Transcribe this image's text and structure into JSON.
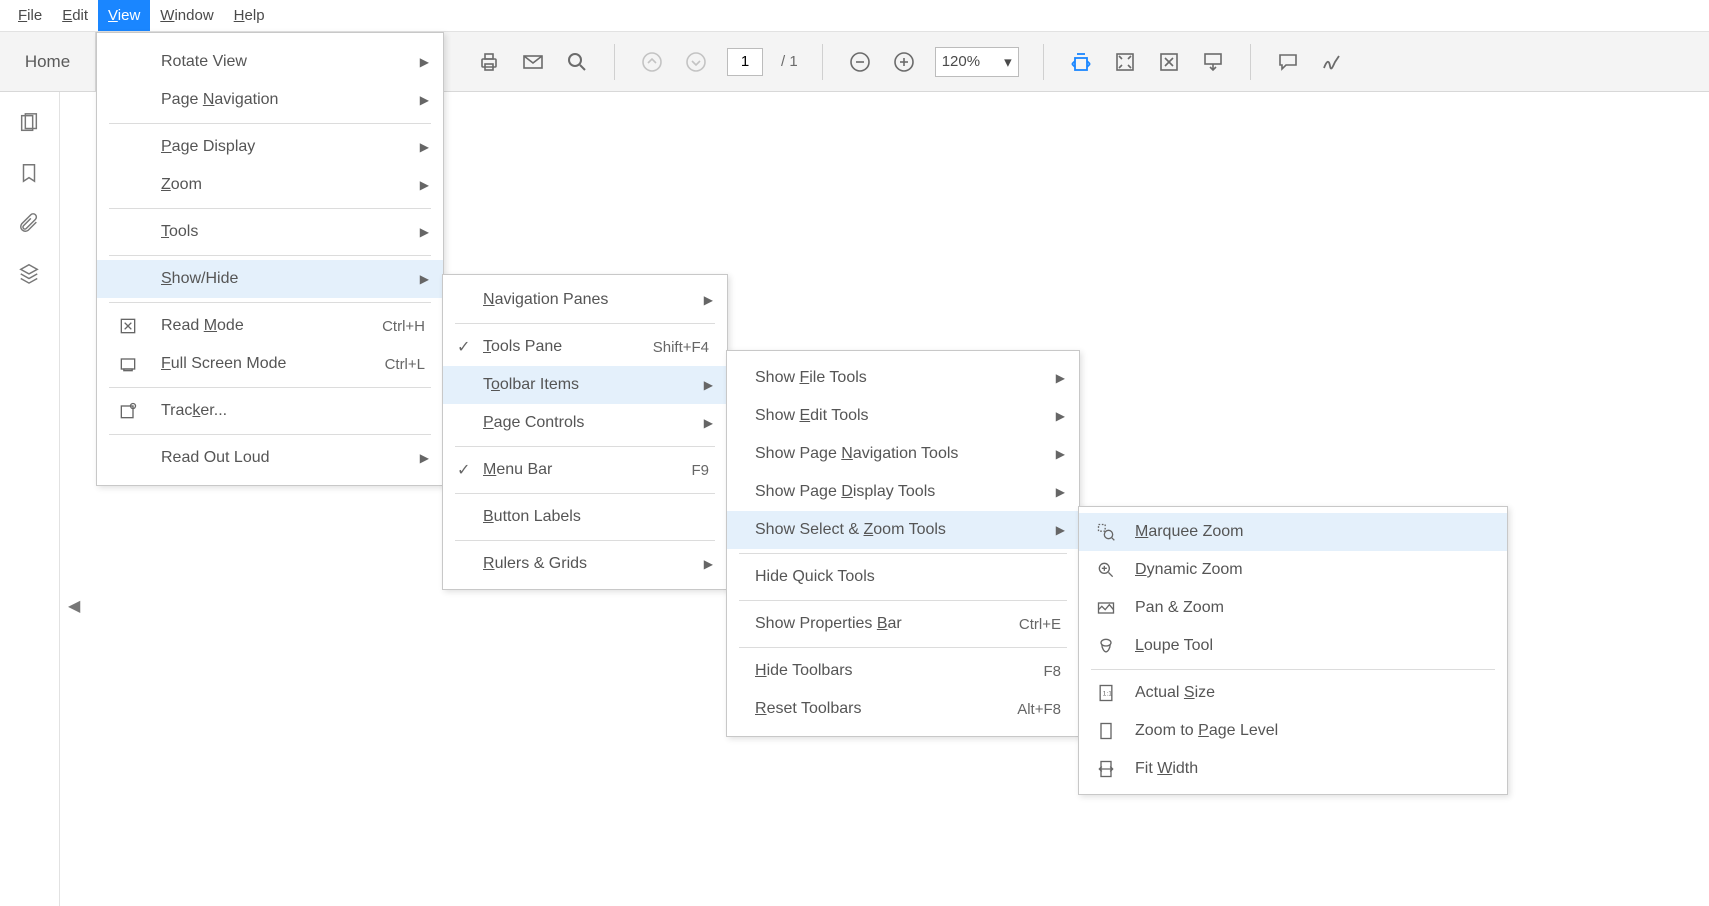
{
  "menubar": {
    "file": "File",
    "edit": "Edit",
    "view": "View",
    "window": "Window",
    "help": "Help"
  },
  "ribbon": {
    "home": "Home",
    "page_current": "1",
    "page_total": "/ 1",
    "zoom": "120%"
  },
  "view_menu": {
    "rotate": "Rotate View",
    "pagenav": "Page Navigation",
    "pagedisp": "Page Display",
    "zoom": "Zoom",
    "tools": "Tools",
    "showhide": "Show/Hide",
    "readmode": "Read Mode",
    "readmode_sc": "Ctrl+H",
    "fullscreen": "Full Screen Mode",
    "fullscreen_sc": "Ctrl+L",
    "tracker": "Tracker...",
    "readoutloud": "Read Out Loud"
  },
  "showhide_menu": {
    "navpanes": "Navigation Panes",
    "toolspane": "Tools Pane",
    "toolspane_sc": "Shift+F4",
    "toolbaritems": "Toolbar Items",
    "pagecontrols": "Page Controls",
    "menubar": "Menu Bar",
    "menubar_sc": "F9",
    "buttonlabels": "Button Labels",
    "rulers": "Rulers & Grids"
  },
  "toolbar_menu": {
    "file": "Show File Tools",
    "edit": "Show Edit Tools",
    "pagenav": "Show Page Navigation Tools",
    "pagedisp": "Show Page Display Tools",
    "selectzoom": "Show Select & Zoom Tools",
    "hidequick": "Hide Quick Tools",
    "propbar": "Show Properties Bar",
    "propbar_sc": "Ctrl+E",
    "hidetoolbars": "Hide Toolbars",
    "hidetoolbars_sc": "F8",
    "resettoolbars": "Reset Toolbars",
    "resettoolbars_sc": "Alt+F8"
  },
  "zoom_menu": {
    "marquee": "Marquee Zoom",
    "dynamic": "Dynamic Zoom",
    "pan": "Pan & Zoom",
    "loupe": "Loupe Tool",
    "actual": "Actual Size",
    "pagelevel": "Zoom to Page Level",
    "fitwidth": "Fit Width"
  }
}
